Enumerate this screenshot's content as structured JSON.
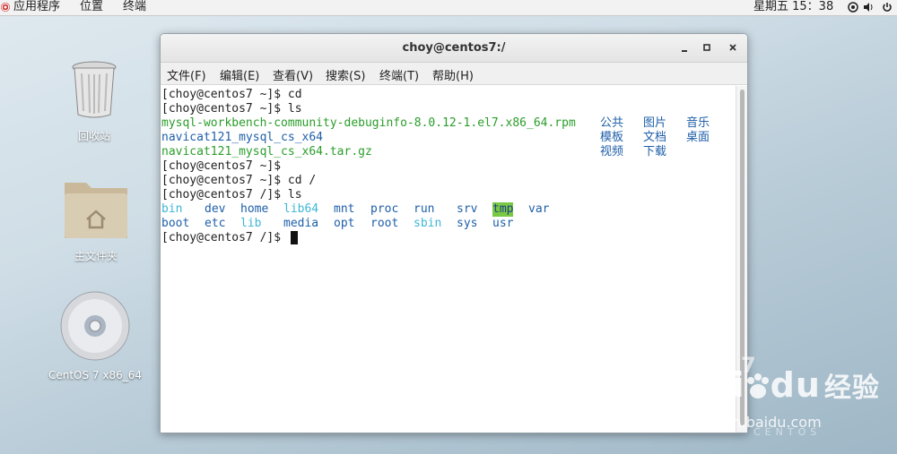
{
  "topbar": {
    "apps_label": "应用程序",
    "places_label": "位置",
    "terminal_label": "终端",
    "clock": "星期五 15：38"
  },
  "desktop": {
    "icons": [
      {
        "label": "回收站"
      },
      {
        "label": "主文件夹"
      },
      {
        "label": "CentOS 7 x86_64"
      }
    ]
  },
  "window": {
    "title": "choy@centos7:/",
    "menu": [
      "文件(F)",
      "编辑(E)",
      "查看(V)",
      "搜索(S)",
      "终端(T)",
      "帮助(H)"
    ]
  },
  "terminal": {
    "prompt1": "[choy@centos7 ~]$ cd",
    "prompt2": "[choy@centos7 ~]$ ls",
    "home_files": [
      "mysql-workbench-community-debuginfo-8.0.12-1.el7.x86_64.rpm",
      "navicat121_mysql_cs_x64",
      "navicat121_mysql_cs_x64.tar.gz"
    ],
    "home_dirs": [
      "公共",
      "图片",
      "音乐",
      "模板",
      "文档",
      "桌面",
      "视频",
      "下载"
    ],
    "prompt3": "[choy@centos7 ~]$",
    "prompt4": "[choy@centos7 ~]$ cd /",
    "prompt5": "[choy@centos7 /]$ ls",
    "root_row1": [
      "bin",
      "dev",
      "home",
      "lib64",
      "mnt",
      "proc",
      "run",
      "srv",
      "tmp",
      "var"
    ],
    "root_row2": [
      "boot",
      "etc",
      "lib",
      "media",
      "opt",
      "root",
      "sbin",
      "sys",
      "usr"
    ],
    "prompt6": "[choy@centos7 /]$"
  },
  "watermark": {
    "brand": "Bai",
    "brand2": "du",
    "brand_cn": "经验",
    "url": "jingyan.baidu.com",
    "os": "CENTOS",
    "version": "7"
  },
  "colors": {
    "ls_file_green": "#2a9d2a",
    "ls_dir_blue": "#1f5fa8",
    "ls_link_cyan": "#3db7d6",
    "tmp_highlight": "#7ac943"
  }
}
